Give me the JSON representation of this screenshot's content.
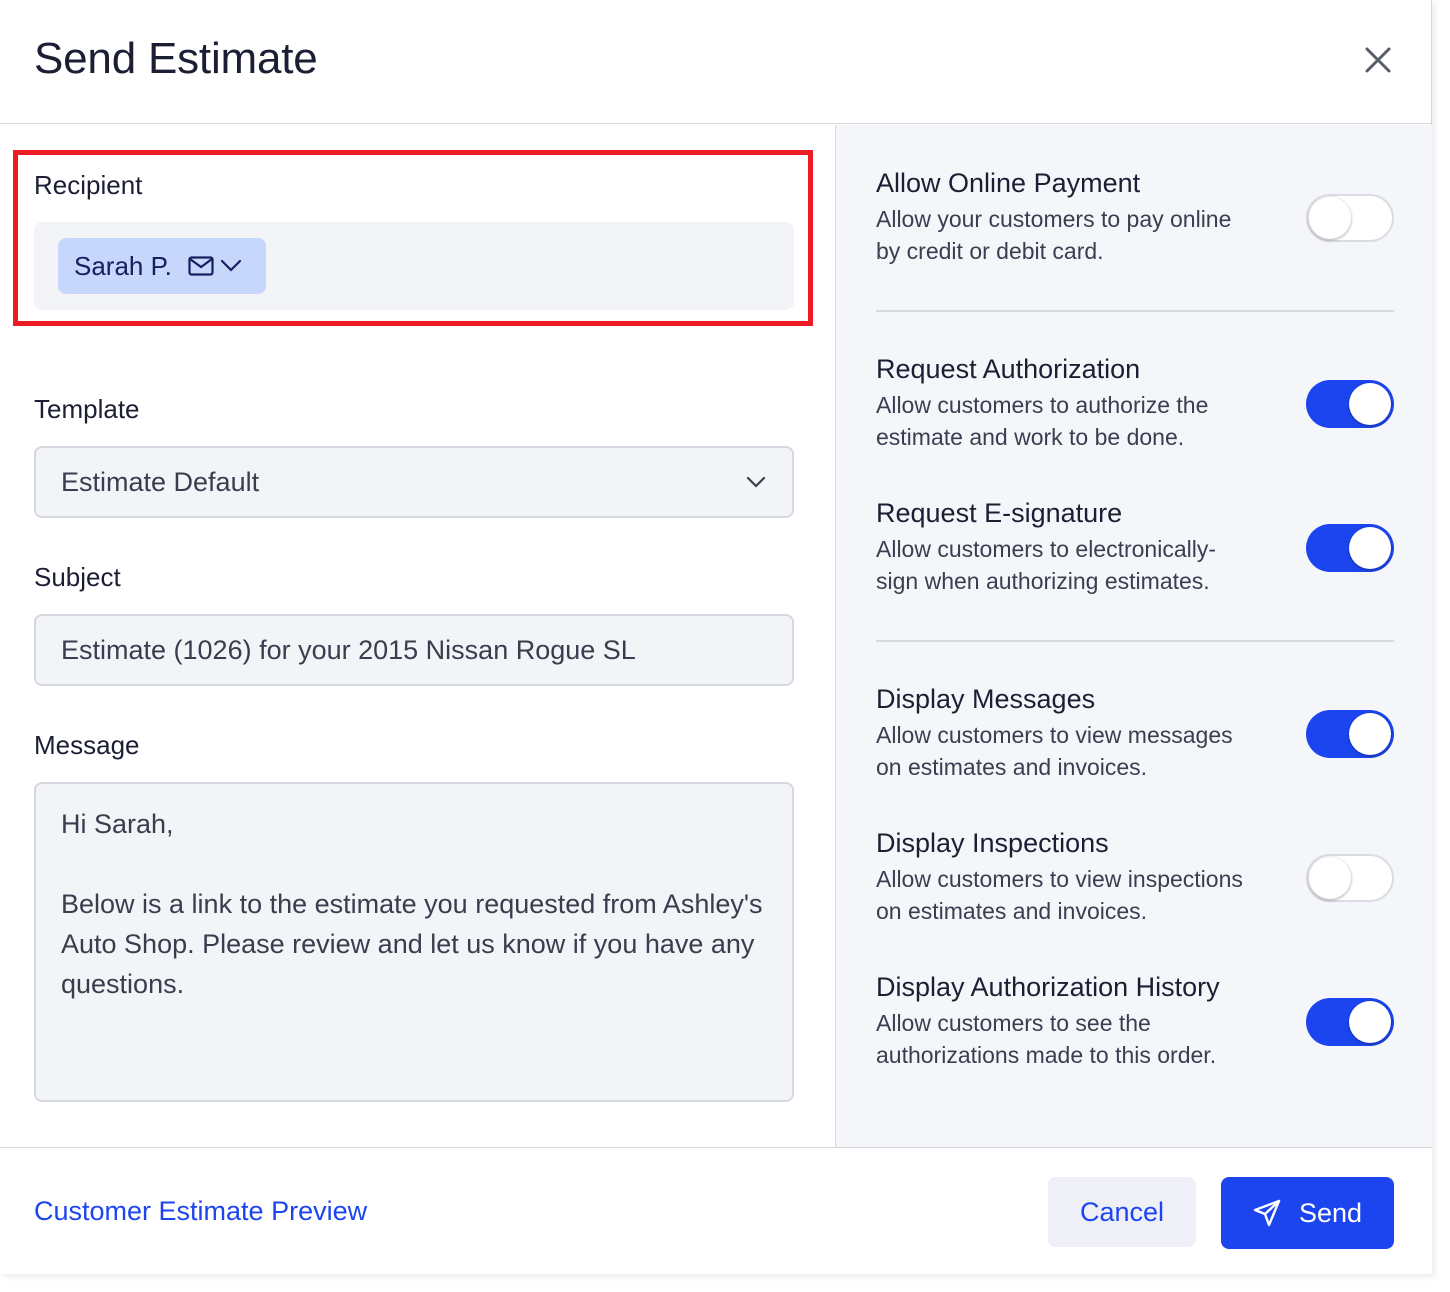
{
  "dialog": {
    "title": "Send Estimate"
  },
  "recipient": {
    "label": "Recipient",
    "chip_name": "Sarah P."
  },
  "template": {
    "label": "Template",
    "value": "Estimate Default"
  },
  "subject": {
    "label": "Subject",
    "value": "Estimate (1026) for your 2015 Nissan Rogue SL"
  },
  "message": {
    "label": "Message",
    "greeting": "Hi Sarah,",
    "body": "Below is a link to the estimate you requested from Ashley's Auto Shop. Please review and let us know if you have any questions."
  },
  "options": [
    {
      "title": "Allow Online Payment",
      "desc_line1": "Allow your customers to pay online",
      "desc_line2": "by credit or debit card.",
      "enabled": false
    },
    {
      "title": "Request Authorization",
      "desc_line1": "Allow customers to authorize the",
      "desc_line2": "estimate and work to be done.",
      "enabled": true
    },
    {
      "title": "Request E-signature",
      "desc_line1": "Allow customers to electronically-",
      "desc_line2": "sign when authorizing estimates.",
      "enabled": true
    },
    {
      "title": "Display Messages",
      "desc_line1": "Allow customers to view messages",
      "desc_line2": "on estimates and invoices.",
      "enabled": true
    },
    {
      "title": "Display Inspections",
      "desc_line1": "Allow customers to view inspections",
      "desc_line2": "on estimates and invoices.",
      "enabled": false
    },
    {
      "title": "Display Authorization History",
      "desc_line1": "Allow customers to see the",
      "desc_line2": "authorizations made to this order.",
      "enabled": true
    }
  ],
  "footer": {
    "preview_link": "Customer Estimate Preview",
    "cancel_label": "Cancel",
    "send_label": "Send"
  },
  "colors": {
    "accent": "#1c45f0",
    "highlight": "#ed1c24",
    "chip_bg": "#c7d6fb",
    "panel_bg": "#f5f6fa"
  },
  "icons": [
    "close-icon",
    "mail-icon",
    "chevron-down-icon",
    "send-icon"
  ]
}
